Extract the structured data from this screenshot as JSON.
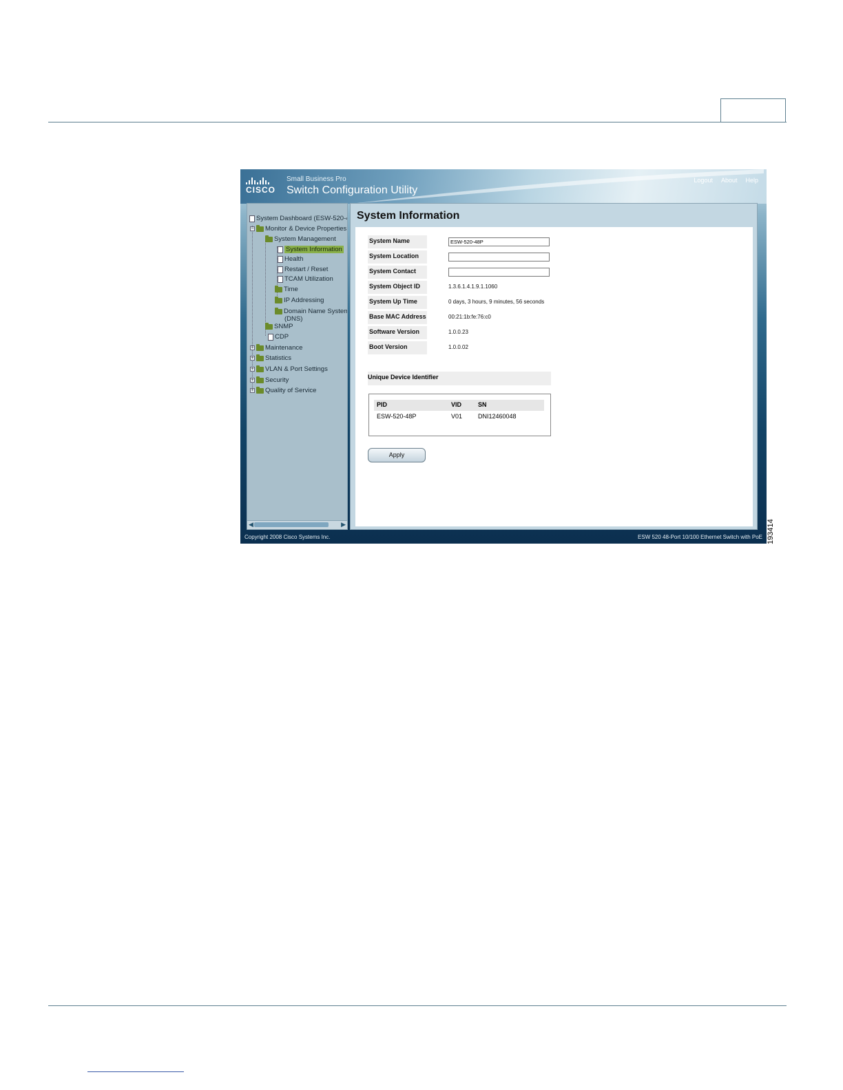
{
  "figure": {
    "id": "193414"
  },
  "header": {
    "logo_text": "CISCO",
    "brand_small": "Small Business Pro",
    "app_title": "Switch Configuration Utility",
    "links": [
      "Logout",
      "About",
      "Help"
    ]
  },
  "nav": {
    "root": "System Dashboard (ESW-520-4",
    "monitor": "Monitor & Device Properties",
    "system_management": "System Management",
    "system_information": "System Information",
    "health": "Health",
    "restart_reset": "Restart / Reset",
    "tcam": "TCAM Utilization",
    "time": "Time",
    "ip_addressing": "IP Addressing",
    "dns_line1": "Domain Name System",
    "dns_line2": "(DNS)",
    "snmp": "SNMP",
    "cdp": "CDP",
    "maintenance": "Maintenance",
    "statistics": "Statistics",
    "vlan": "VLAN & Port Settings",
    "security": "Security",
    "qos": "Quality of Service"
  },
  "main": {
    "title": "System Information",
    "fields": {
      "system_name_label": "System Name",
      "system_name_value": "ESW-520-48P",
      "system_location_label": "System Location",
      "system_location_value": "",
      "system_contact_label": "System Contact",
      "system_contact_value": "",
      "object_id_label": "System Object ID",
      "object_id_value": "1.3.6.1.4.1.9.1.1060",
      "uptime_label": "System Up Time",
      "uptime_value": "0 days, 3 hours, 9 minutes, 56 seconds",
      "mac_label": "Base MAC Address",
      "mac_value": "00:21:1b:fe:76:c0",
      "software_label": "Software Version",
      "software_value": "1.0.0.23",
      "boot_label": "Boot Version",
      "boot_value": "1.0.0.02"
    },
    "udi": {
      "heading": "Unique Device Identifier",
      "headers": {
        "pid": "PID",
        "vid": "VID",
        "sn": "SN"
      },
      "row": {
        "pid": "ESW-520-48P",
        "vid": "V01",
        "sn": "DNI12460048"
      }
    },
    "apply_label": "Apply"
  },
  "footer": {
    "copyright": "Copyright 2008 Cisco Systems Inc.",
    "product": "ESW 520 48-Port 10/100 Ethernet Switch with PoE"
  }
}
